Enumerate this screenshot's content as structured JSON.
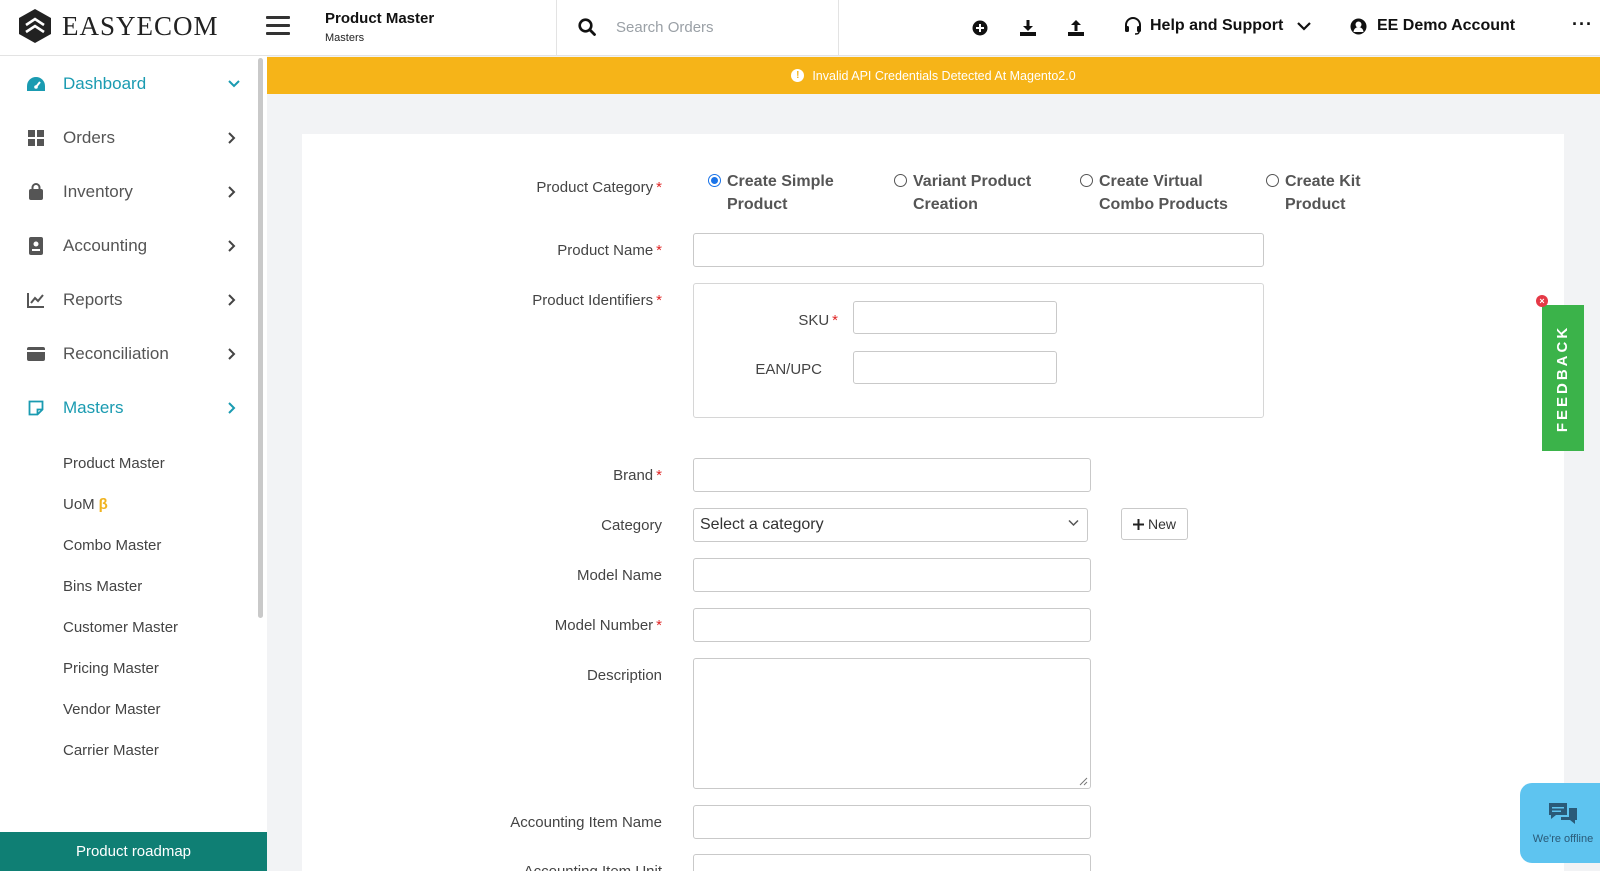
{
  "app": {
    "logo_text": "EASYECOM",
    "page_title": "Product Master",
    "page_subtitle": "Masters"
  },
  "search": {
    "placeholder": "Search Orders"
  },
  "header": {
    "icons": [
      "plus-circle-icon",
      "download-icon",
      "upload-icon"
    ],
    "help_label": "Help and Support",
    "account_label": "EE Demo Account",
    "more_label": "···"
  },
  "banner": {
    "text": "Invalid API Credentials Detected At Magento2.0",
    "color": "#f6b418"
  },
  "sidebar": {
    "items": [
      {
        "label": "Dashboard",
        "icon": "dashboard-icon",
        "active": true
      },
      {
        "label": "Orders",
        "icon": "grid-icon"
      },
      {
        "label": "Inventory",
        "icon": "bag-icon"
      },
      {
        "label": "Accounting",
        "icon": "ledger-icon"
      },
      {
        "label": "Reports",
        "icon": "chart-icon"
      },
      {
        "label": "Reconciliation",
        "icon": "wallet-icon"
      },
      {
        "label": "Masters",
        "icon": "note-icon",
        "active": true
      }
    ],
    "sub_items": [
      {
        "label": "Product Master"
      },
      {
        "label": "UoM",
        "badge": "β"
      },
      {
        "label": "Combo Master"
      },
      {
        "label": "Bins Master"
      },
      {
        "label": "Customer Master"
      },
      {
        "label": "Pricing Master"
      },
      {
        "label": "Vendor Master"
      },
      {
        "label": "Carrier Master"
      }
    ],
    "roadmap_label": "Product roadmap"
  },
  "form": {
    "product_category": {
      "label": "Product Category",
      "options": [
        {
          "line1": "Create Simple",
          "line2": "Product",
          "selected": true
        },
        {
          "line1": "Variant Product",
          "line2": "Creation",
          "selected": false
        },
        {
          "line1": "Create Virtual",
          "line2": "Combo Products",
          "selected": false
        },
        {
          "line1": "Create Kit",
          "line2": "Product",
          "selected": false
        }
      ]
    },
    "product_name_label": "Product Name",
    "product_identifiers_label": "Product Identifiers",
    "sku_label": "SKU",
    "ean_label": "EAN/UPC",
    "brand_label": "Brand",
    "category_label": "Category",
    "category_placeholder": "Select a category",
    "new_button_label": "New",
    "model_name_label": "Model Name",
    "model_number_label": "Model Number",
    "description_label": "Description",
    "accounting_item_name_label": "Accounting Item Name",
    "accounting_item_unit_label": "Accounting Item Unit",
    "required_mark": "*"
  },
  "feedback": {
    "label": "FEEDBACK",
    "close": "×",
    "color": "#3bb34a"
  },
  "chat": {
    "status": "We're offline",
    "color": "#5ec4f0"
  }
}
